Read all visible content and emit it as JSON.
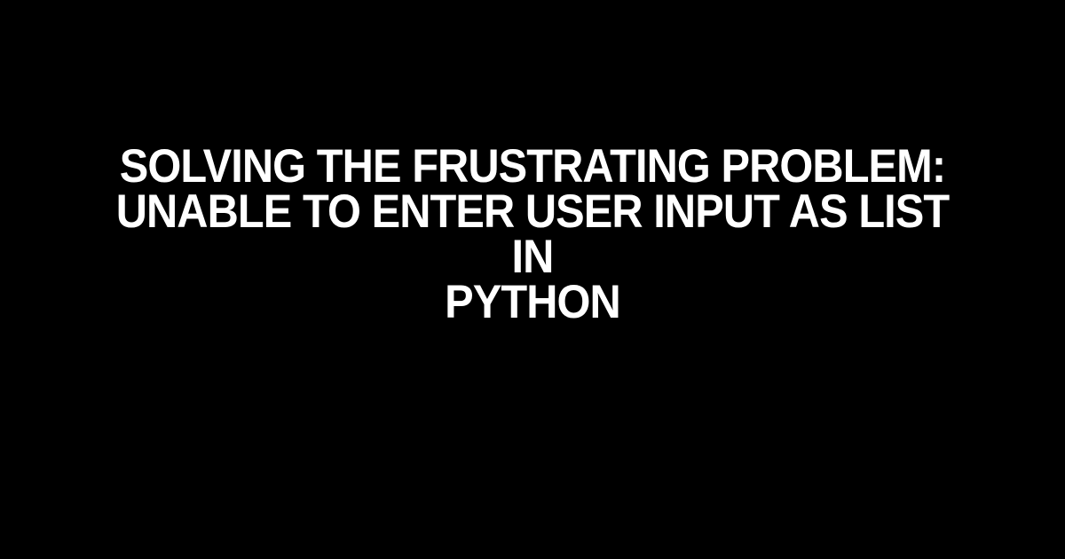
{
  "headline": {
    "line1": "SOLVING THE FRUSTRATING PROBLEM:",
    "line2": "UNABLE TO ENTER USER INPUT AS LIST IN",
    "line3": "PYTHON"
  }
}
